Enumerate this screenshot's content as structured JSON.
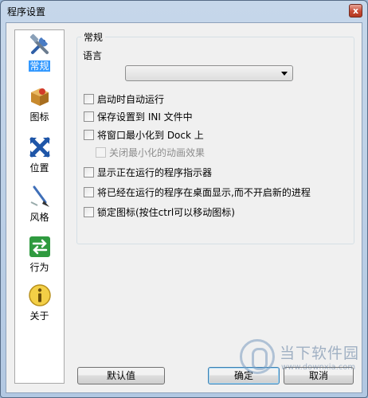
{
  "window": {
    "title": "程序设置",
    "close_symbol": "x"
  },
  "sidebar": {
    "items": [
      {
        "label": "常规",
        "icon": "tools-icon",
        "selected": true
      },
      {
        "label": "图标",
        "icon": "package-icon",
        "selected": false
      },
      {
        "label": "位置",
        "icon": "position-arrows-icon",
        "selected": false
      },
      {
        "label": "风格",
        "icon": "brush-icon",
        "selected": false
      },
      {
        "label": "行为",
        "icon": "swap-arrows-icon",
        "selected": false
      },
      {
        "label": "关于",
        "icon": "info-icon",
        "selected": false
      }
    ]
  },
  "general": {
    "group_title": "常规",
    "language_label": "语言",
    "language_value": "",
    "options": [
      {
        "label": "启动时自动运行",
        "checked": false,
        "enabled": true
      },
      {
        "label": "保存设置到 INI 文件中",
        "checked": false,
        "enabled": true
      },
      {
        "label": "将窗口最小化到 Dock 上",
        "checked": false,
        "enabled": true
      },
      {
        "label": "关闭最小化的动画效果",
        "checked": false,
        "enabled": false
      },
      {
        "label": "显示正在运行的程序指示器",
        "checked": false,
        "enabled": true
      },
      {
        "label": "将已经在运行的程序在桌面显示,而不开启新的进程",
        "checked": false,
        "enabled": true
      },
      {
        "label": "锁定图标(按住ctrl可以移动图标)",
        "checked": false,
        "enabled": true
      }
    ]
  },
  "buttons": {
    "default_label": "默认值",
    "ok_label": "确定",
    "cancel_label": "取消"
  },
  "watermark": {
    "text": "当下软件园",
    "url": "www.downxia.com"
  },
  "colors": {
    "selection": "#3399ff",
    "title_bar": "#c6d7ea",
    "close_button": "#c74b36"
  }
}
